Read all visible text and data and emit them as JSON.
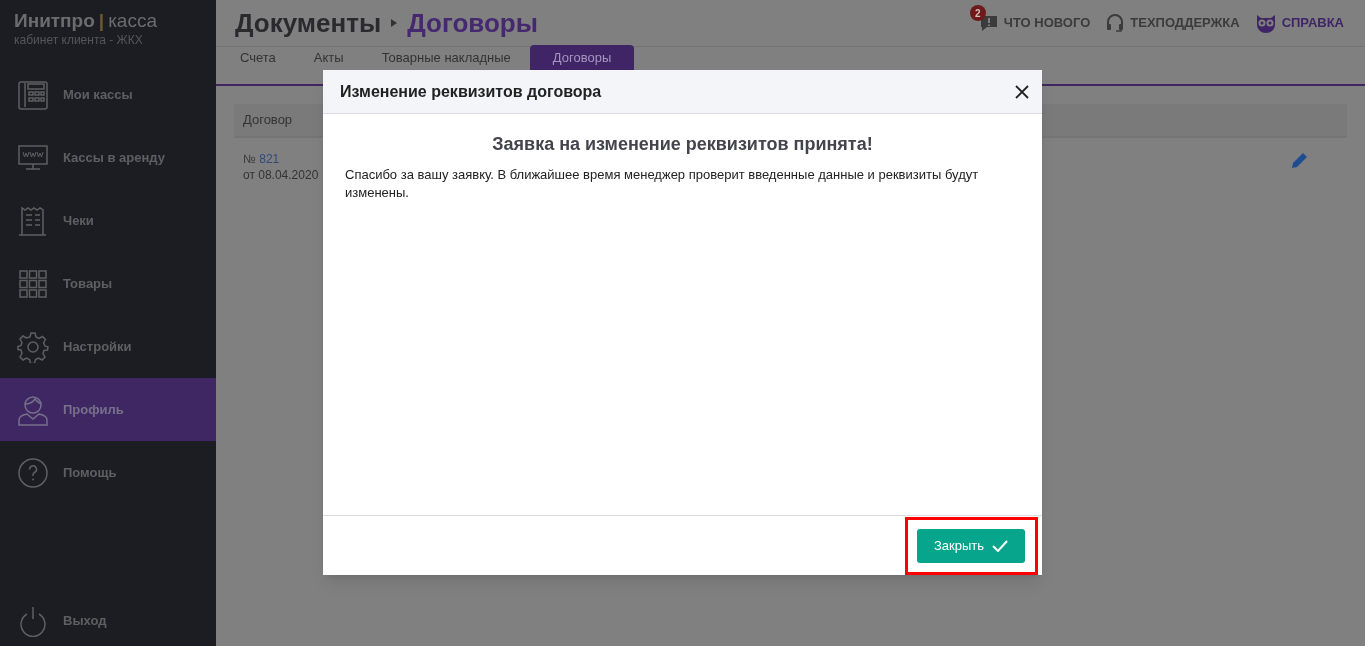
{
  "brand": {
    "name": "Инитпро",
    "separator": "|",
    "product": "касса",
    "subtitle": "кабинет клиента - ЖКХ"
  },
  "nav": [
    {
      "label": "Мои кассы",
      "kind": "register",
      "selected": false
    },
    {
      "label": "Кассы в аренду",
      "kind": "monitor",
      "selected": false
    },
    {
      "label": "Чеки",
      "kind": "receipt",
      "selected": false
    },
    {
      "label": "Товары",
      "kind": "grid",
      "selected": false
    },
    {
      "label": "Настройки",
      "kind": "gear",
      "selected": false
    },
    {
      "label": "Профиль",
      "kind": "user",
      "selected": true
    },
    {
      "label": "Помощь",
      "kind": "help",
      "selected": false
    }
  ],
  "logout": {
    "label": "Выход"
  },
  "breadcrumb": [
    "Документы",
    "Договоры"
  ],
  "top_links": [
    {
      "label": "ЧТО НОВОГО",
      "kind": "news",
      "badge": "2"
    },
    {
      "label": "ТЕХПОДДЕРЖКА",
      "kind": "support"
    },
    {
      "label": "СПРАВКА",
      "kind": "help"
    }
  ],
  "tabs": [
    {
      "label": "Счета",
      "selected": false
    },
    {
      "label": "Акты",
      "selected": false
    },
    {
      "label": "Товарные накладные",
      "selected": false
    },
    {
      "label": "Договоры",
      "selected": true
    }
  ],
  "table": {
    "columns": [
      "Договор"
    ],
    "rows": [
      {
        "number_prefix": "№",
        "number": "821",
        "date_prefix": "от",
        "date": "08.04.2020"
      }
    ]
  },
  "modal": {
    "title": "Изменение реквизитов договора",
    "heading": "Заявка на изменение реквизитов принята!",
    "message": "Спасибо за вашу заявку. В ближайшее время менеджер проверит введенные данные и реквизиты будут изменены.",
    "button": "Закрыть",
    "button_highlighted": true
  }
}
